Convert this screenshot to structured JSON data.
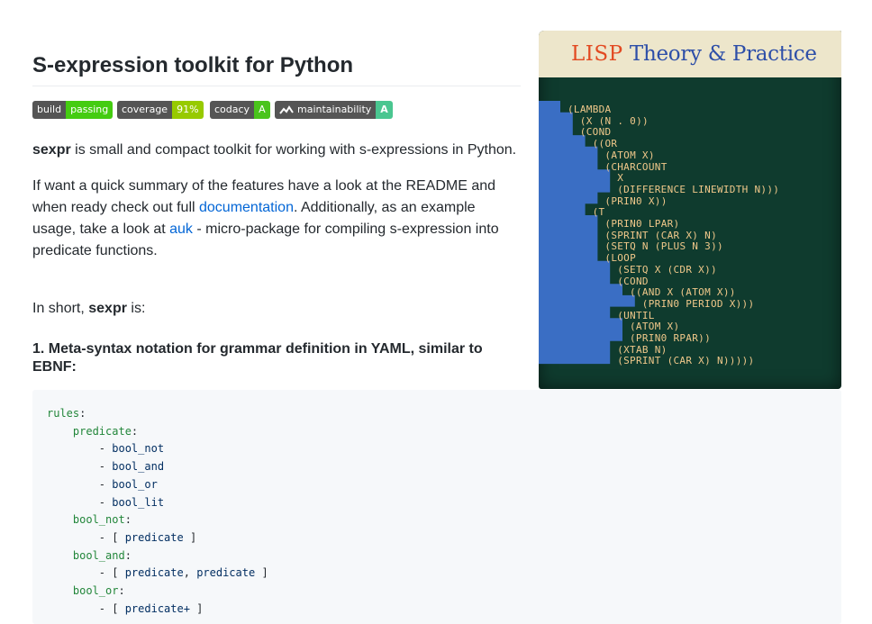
{
  "cover": {
    "title_lisp": "LISP",
    "title_rest": "Theory & Practice",
    "code_lines": [
      "(LAMBDA",
      "  (X (N . 0))",
      "  (COND",
      "    ((OR",
      "      (ATOM X)",
      "      (CHARCOUNT",
      "        X",
      "        (DIFFERENCE LINEWIDTH N)))",
      "      (PRIN0 X))",
      "    (T",
      "      (PRIN0 LPAR)",
      "      (SPRINT (CAR X) N)",
      "      (SETQ N (PLUS N 3))",
      "      (LOOP",
      "        (SETQ X (CDR X))",
      "        (COND",
      "          ((AND X (ATOM X))",
      "            (PRIN0 PERIOD X)))",
      "        (UNTIL",
      "          (ATOM X)",
      "          (PRIN0 RPAR))",
      "        (XTAB N)",
      "        (SPRINT (CAR X) N)))))"
    ],
    "colors": {
      "paper": "#ede6cb",
      "board": "#0f3b2e",
      "stairs": "#3a6ec4",
      "code": "#f0c88a",
      "lisp": "#e24a22",
      "rest": "#2e4fa8"
    }
  },
  "header": {
    "title": "S-expression toolkit for Python"
  },
  "badges": [
    {
      "left": "build",
      "right": "passing",
      "color": "#4c1"
    },
    {
      "left": "coverage",
      "right": "91%",
      "color": "#97ca00"
    },
    {
      "left": "codacy",
      "right": "A",
      "color": "#4ac41c"
    },
    {
      "left": "maintainability",
      "right": "A",
      "color": "#4ac690",
      "icon": "code-climate-icon"
    }
  ],
  "intro": {
    "name": "sexpr",
    "text": " is small and compact toolkit for working with s-expressions in Python."
  },
  "docs_para": {
    "p1": "If want a quick summary of the features have a look at the README and when ready check out full ",
    "link_docs": "documentation",
    "p2": ". Additionally, as an example usage, take a look at ",
    "link_auk": "auk",
    "p3": " - micro-package for compiling s-expression into predicate functions."
  },
  "short": {
    "prefix": "In short, ",
    "name": "sexpr",
    "suffix": " is:"
  },
  "section1": {
    "title": "1. Meta-syntax notation for grammar definition in YAML, similar to EBNF:"
  },
  "code": {
    "lines": [
      [
        {
          "t": "rules",
          "c": "k"
        },
        {
          "t": ":",
          "c": "d"
        }
      ],
      [
        {
          "t": "    predicate",
          "c": "k"
        },
        {
          "t": ":",
          "c": "d"
        }
      ],
      [
        {
          "t": "        - ",
          "c": "d"
        },
        {
          "t": "bool_not",
          "c": "s"
        }
      ],
      [
        {
          "t": "        - ",
          "c": "d"
        },
        {
          "t": "bool_and",
          "c": "s"
        }
      ],
      [
        {
          "t": "        - ",
          "c": "d"
        },
        {
          "t": "bool_or",
          "c": "s"
        }
      ],
      [
        {
          "t": "        - ",
          "c": "d"
        },
        {
          "t": "bool_lit",
          "c": "s"
        }
      ],
      [
        {
          "t": "    bool_not",
          "c": "k"
        },
        {
          "t": ":",
          "c": "d"
        }
      ],
      [
        {
          "t": "        - [ ",
          "c": "d"
        },
        {
          "t": "predicate",
          "c": "s"
        },
        {
          "t": " ]",
          "c": "d"
        }
      ],
      [
        {
          "t": "    bool_and",
          "c": "k"
        },
        {
          "t": ":",
          "c": "d"
        }
      ],
      [
        {
          "t": "        - [ ",
          "c": "d"
        },
        {
          "t": "predicate",
          "c": "s"
        },
        {
          "t": ", ",
          "c": "d"
        },
        {
          "t": "predicate",
          "c": "s"
        },
        {
          "t": " ]",
          "c": "d"
        }
      ],
      [
        {
          "t": "    bool_or",
          "c": "k"
        },
        {
          "t": ":",
          "c": "d"
        }
      ],
      [
        {
          "t": "        - [ ",
          "c": "d"
        },
        {
          "t": "predicate+",
          "c": "s"
        },
        {
          "t": " ]",
          "c": "d"
        }
      ]
    ]
  }
}
